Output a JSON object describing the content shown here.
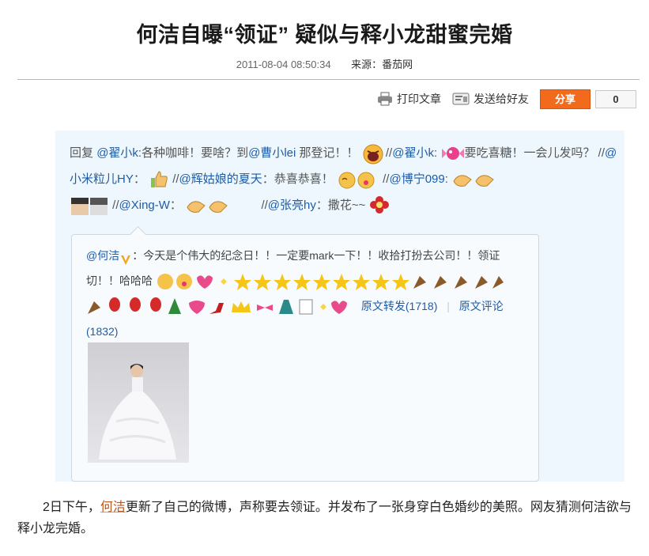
{
  "article": {
    "title": "何洁自曝“领证” 疑似与释小龙甜蜜完婚",
    "date": "2011-08-04 08:50:34",
    "source": "来源：番茄网"
  },
  "toolbar": {
    "print_label": "打印文章",
    "send_label": "发送给好友",
    "share_label": "分享",
    "share_count": "0"
  },
  "weibo": {
    "repost": {
      "reply_prefix": "回复",
      "user1": "@翟小k",
      "text1": ":各种咖啡！要啥？到",
      "user2": "@曹小lei",
      "text2": "那登记！！",
      "sep1": "//",
      "user3": "@翟小k",
      "text3": ":",
      "text4": "要吃喜糖！一会儿发吗？",
      "sep2": "//",
      "user4": "@小米粒儿HY",
      "text5": "：",
      "sep3": "//",
      "user5": "@辉姑娘的夏天",
      "text6": "：恭喜恭喜！",
      "sep4": "//",
      "user6": "@博宁099",
      "text7": ":",
      "sep5": "//",
      "user7": "@Xing-W",
      "text8": "：",
      "sep6": "//",
      "user8": "@张亮hy",
      "text9": "：撒花~~"
    },
    "original": {
      "author": "@何洁",
      "text": "：今天是个伟大的纪念日！！一定要mark一下！！收拾打扮去公司！！领证切！！哈哈哈",
      "repost_link": "原文转发(1718)",
      "divider": "|",
      "comment_link": "原文评论(1832)"
    }
  },
  "content": {
    "para_start": "2日下午，",
    "name_link": "何洁",
    "para_rest": "更新了自己的微博，声称要去领证。并发布了一张身穿白色婚纱的美照。网友猜测何洁欲与释小龙完婚。"
  },
  "colors": {
    "link": "#1e5ca8",
    "share_button": "#f26a1b",
    "weibo_bg": "#edf7fd"
  }
}
